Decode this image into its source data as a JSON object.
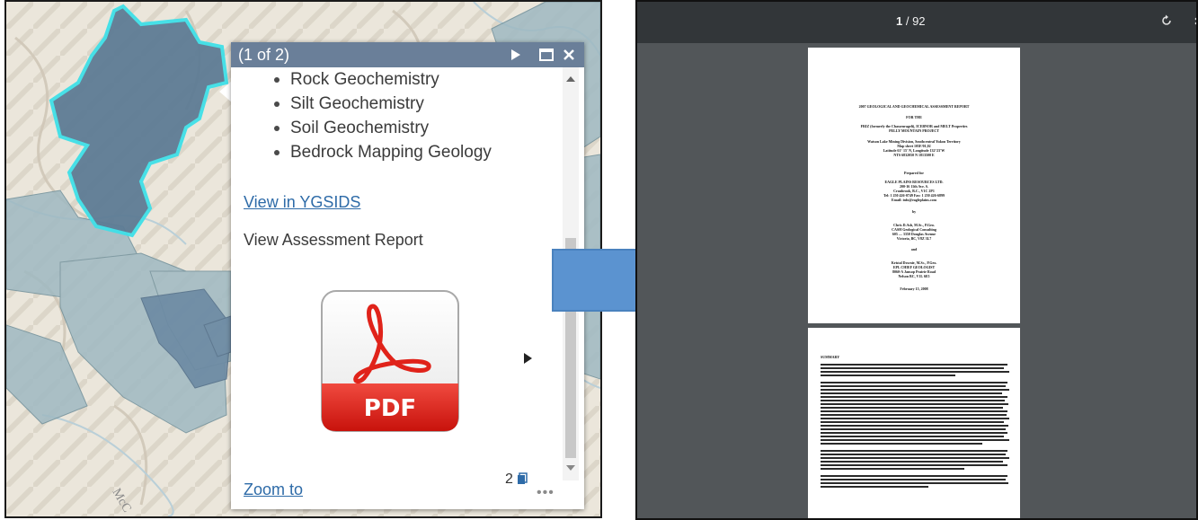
{
  "popup": {
    "count": "(1 of 2)",
    "features": [
      "Rock Geochemistry",
      "Silt Geochemistry",
      "Soil Geochemistry",
      "Bedrock Mapping Geology"
    ],
    "view_ygsids": "View in YGSIDS",
    "view_report": "View Assessment Report",
    "pdf_label": "PDF",
    "attachment_count": "2",
    "zoom_to": "Zoom to",
    "more": "•••"
  },
  "map": {
    "place_label": "McC"
  },
  "viewer": {
    "page_current": "1",
    "page_sep": " / ",
    "page_total": "92",
    "page1": {
      "title": "2007 GEOLOGICAL AND GEOCHEMICAL ASSESSMENT REPORT",
      "for_the": "FOR THE",
      "props": "FRIZ (formerly the Chasseurageli), ICEBNOR and MELT Properties",
      "project": "PELLY MOUNTAIN PROJECT",
      "district": "Watson Lake Mining Division, Southcentral Yukon Territory",
      "nts": "Map sheet 105F/01,02",
      "latlong": "Latitude 61° 15' N, Longitude 132°23'W",
      "utm": "NTS 6832050 N 1813500 E",
      "prepared": "Prepared for",
      "company": "EAGLE PLAINS RESOURCES LTD.",
      "addr1": "200-16 11th Ave. S.",
      "addr2": "Cranbrook, B.C., V1C 2P1",
      "tel": "Tel: 1 250 426-0749     Fax: 1 250 426-6899",
      "email": "Email: info@eagleplains.com",
      "by": "by",
      "author1": "Chris D.Ash, M.Sc., P.Geo.",
      "author1b": "CASH Geological Consulting",
      "author1c": "605 — 3350 Douglas Avenue",
      "author1d": "Victoria, BC, V8Z 3L7",
      "and": "and",
      "author2": "Kristal Downie, M.Sc., P.Geo.",
      "author2b": "EPL CHIEF GEOLOGIST",
      "author2c": "8060-A Jansop Prairie Road",
      "author2d": "Nelson BC, V1L 6E5",
      "date": "February 15, 2008"
    },
    "page2": {
      "heading": "SUMMARY"
    }
  }
}
